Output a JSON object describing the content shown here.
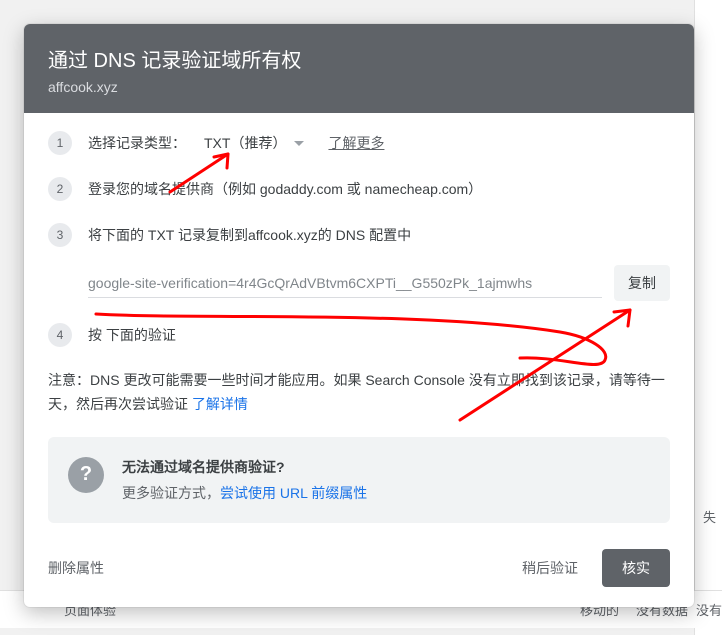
{
  "dialog": {
    "title": "通过 DNS 记录验证域所有权",
    "subtitle": "affcook.xyz",
    "step1": {
      "label": "选择记录类型：",
      "dropdown": "TXT（推荐）",
      "learn_more": "了解更多"
    },
    "step2": "登录您的域名提供商（例如 godaddy.com 或 namecheap.com）",
    "step3": "将下面的 TXT 记录复制到affcook.xyz的 DNS 配置中",
    "txt_value": "google-site-verification=4r4GcQrAdVBtvm6CXPTi__G550zPk_1ajmwhs",
    "copy": "复制",
    "step4": "按 下面的验证",
    "note_a": "注意：DNS 更改可能需要一些时间才能应用。如果 Search Console 没有立即找到该记录，请等待一天，然后再次尝试验证 ",
    "note_link": "了解详情",
    "info_head": "无法通过域名提供商验证?",
    "info_body_a": "更多验证方式，",
    "info_body_link": "尝试使用 URL 前缀属性",
    "delete": "删除属性",
    "later": "稍后验证",
    "verify": "核实",
    "step_nums": [
      "1",
      "2",
      "3",
      "4"
    ]
  },
  "bg": {
    "row_a": "页面体验",
    "row_b": "移动的",
    "row_c": "没有数据",
    "row_d": "没有",
    "rhead": "失"
  }
}
